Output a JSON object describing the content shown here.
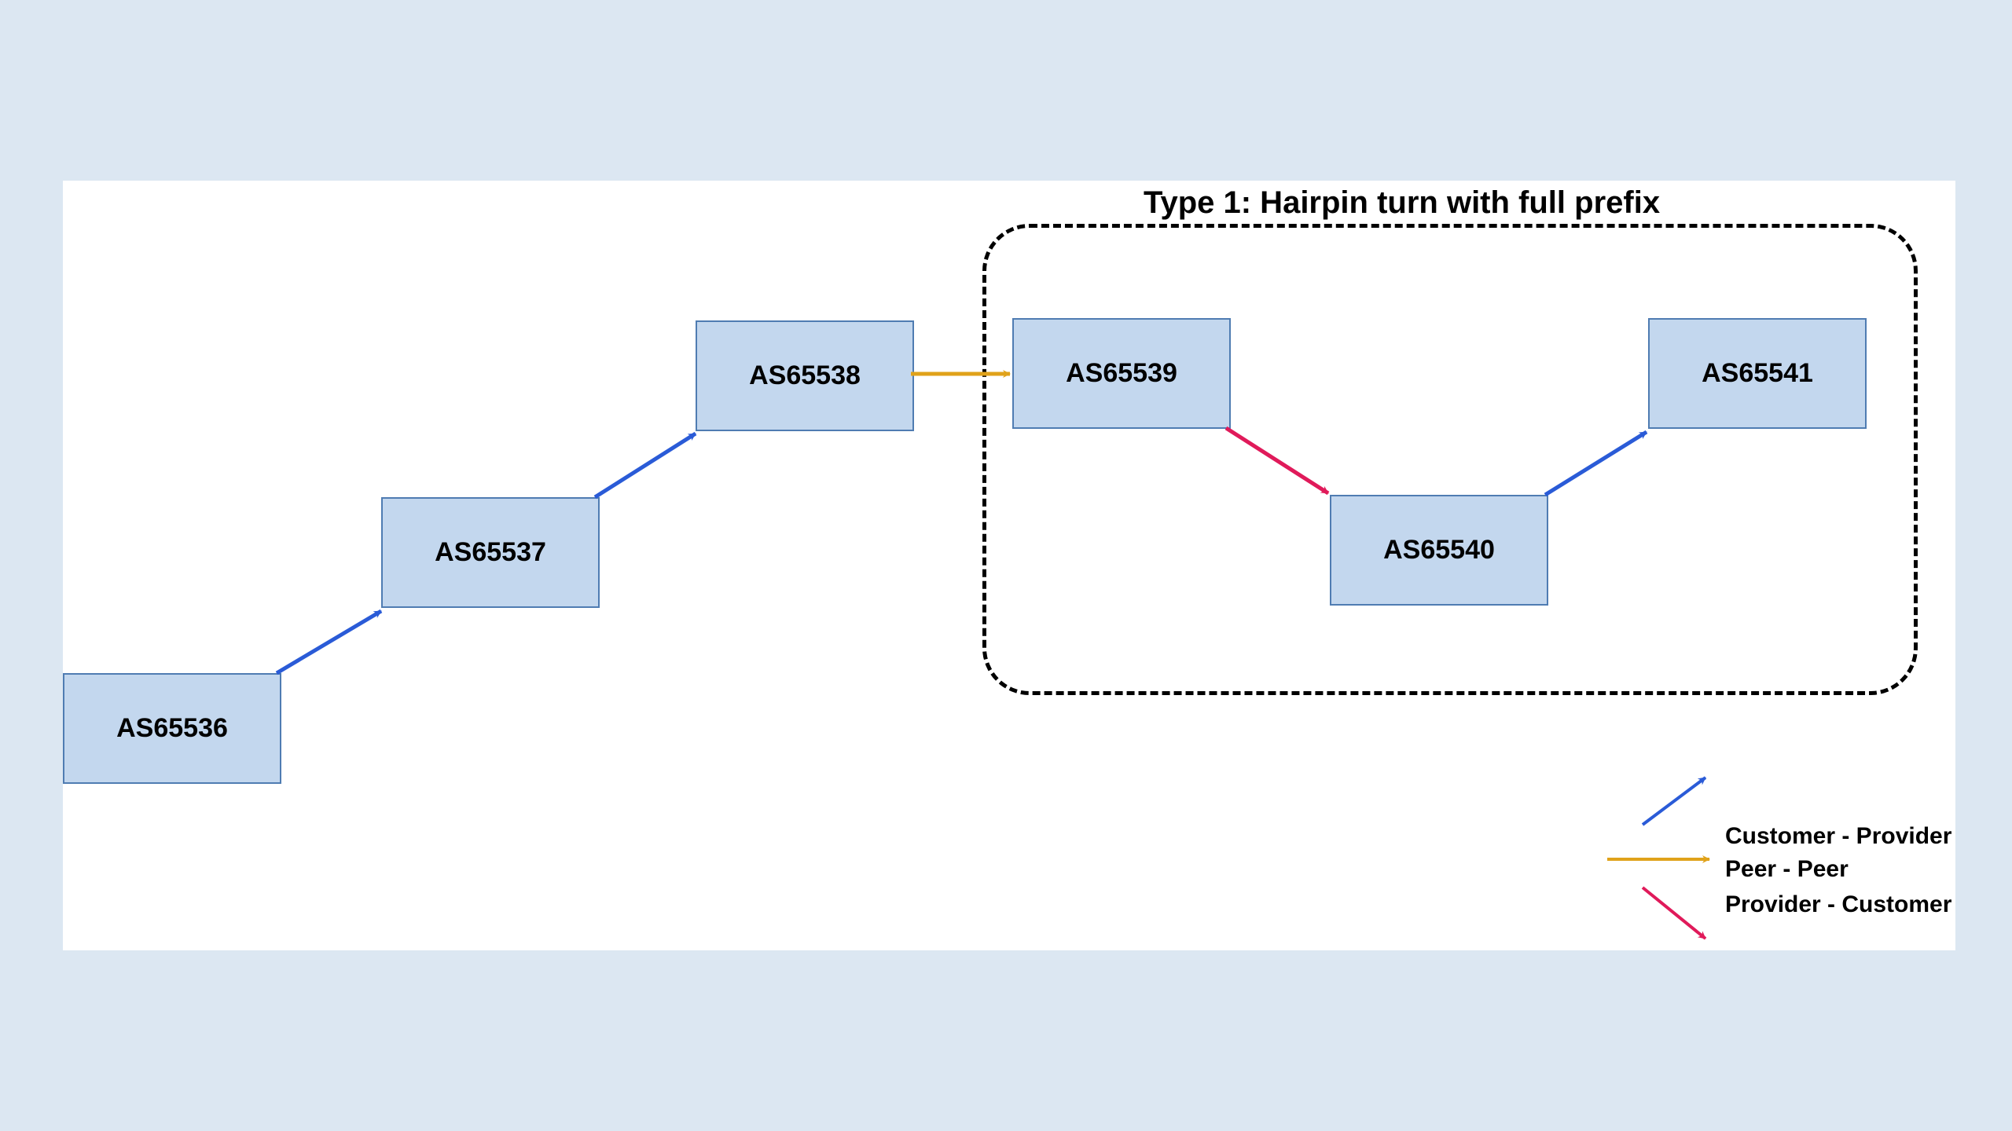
{
  "title": "Type 1: Hairpin turn with full prefix",
  "nodes": {
    "n1": "AS65536",
    "n2": "AS65537",
    "n3": "AS65538",
    "n4": "AS65539",
    "n5": "AS65540",
    "n6": "AS65541"
  },
  "legend": {
    "cust_prov": "Customer - Provider",
    "peer_peer": "Peer - Peer",
    "prov_cust": "Provider - Customer"
  },
  "colors": {
    "customer_provider": "#2a5bd7",
    "peer_peer": "#e0a21a",
    "provider_customer": "#e01a5a",
    "node_fill": "#c3d7ee",
    "node_border": "#4f7cb2",
    "page_bg": "#dce7f2"
  },
  "chart_data": {
    "type": "diagram",
    "description": "BGP AS-path relationship diagram showing a hairpin turn with full prefix",
    "nodes": [
      {
        "id": "AS65536"
      },
      {
        "id": "AS65537"
      },
      {
        "id": "AS65538"
      },
      {
        "id": "AS65539"
      },
      {
        "id": "AS65540"
      },
      {
        "id": "AS65541"
      }
    ],
    "edges": [
      {
        "from": "AS65536",
        "to": "AS65537",
        "relation": "customer-provider"
      },
      {
        "from": "AS65537",
        "to": "AS65538",
        "relation": "customer-provider"
      },
      {
        "from": "AS65538",
        "to": "AS65539",
        "relation": "peer-peer"
      },
      {
        "from": "AS65539",
        "to": "AS65540",
        "relation": "provider-customer"
      },
      {
        "from": "AS65540",
        "to": "AS65541",
        "relation": "customer-provider"
      }
    ],
    "region": {
      "label": "Type 1: Hairpin turn with full prefix",
      "contains": [
        "AS65539",
        "AS65540",
        "AS65541"
      ]
    },
    "legend": [
      {
        "label": "Customer - Provider",
        "color": "#2a5bd7"
      },
      {
        "label": "Peer - Peer",
        "color": "#e0a21a"
      },
      {
        "label": "Provider - Customer",
        "color": "#e01a5a"
      }
    ]
  }
}
